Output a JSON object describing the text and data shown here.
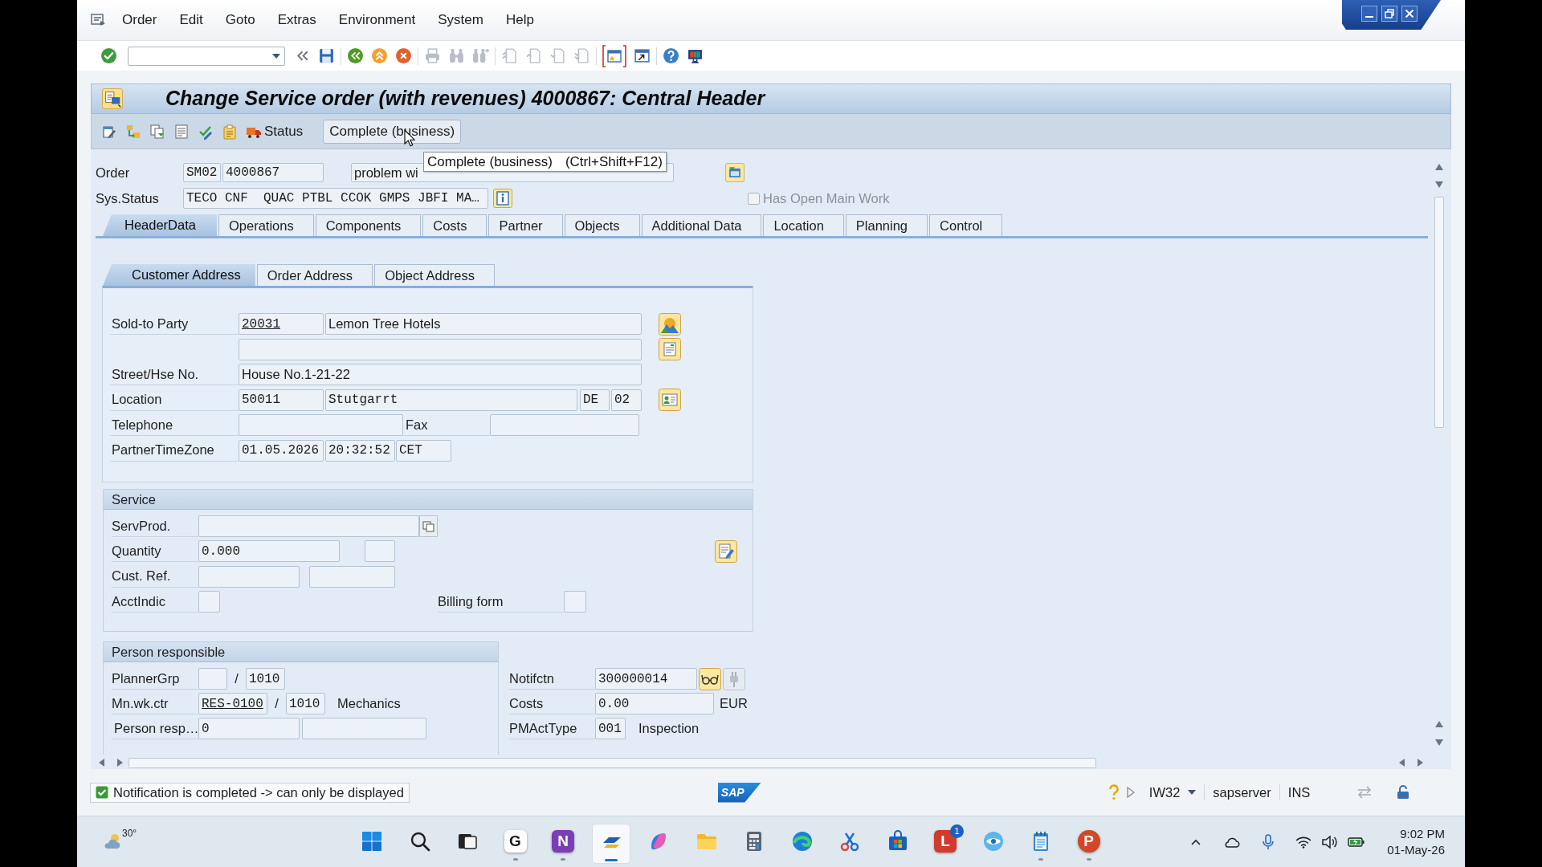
{
  "menu_bar": {
    "items": [
      "Order",
      "Edit",
      "Goto",
      "Extras",
      "Environment",
      "System",
      "Help"
    ]
  },
  "toolbar": {
    "groups": [
      [
        {
          "kind": "enter",
          "disabled": false,
          "focused": false
        }
      ],
      [
        {
          "kind": "collapse",
          "disabled": false,
          "focused": false
        },
        {
          "kind": "save",
          "disabled": false,
          "focused": false
        }
      ],
      [
        {
          "kind": "back",
          "disabled": false,
          "focused": false
        },
        {
          "kind": "exit",
          "disabled": false,
          "focused": false
        },
        {
          "kind": "cancel",
          "disabled": false,
          "focused": false
        }
      ],
      [
        {
          "kind": "print",
          "disabled": true,
          "focused": false
        },
        {
          "kind": "find",
          "disabled": true,
          "focused": false
        },
        {
          "kind": "find_next",
          "disabled": true,
          "focused": false
        }
      ],
      [
        {
          "kind": "first_page",
          "disabled": true,
          "focused": false
        },
        {
          "kind": "previous_page",
          "disabled": true,
          "focused": false
        },
        {
          "kind": "next_page",
          "disabled": true,
          "focused": false
        },
        {
          "kind": "last_page",
          "disabled": true,
          "focused": false
        }
      ],
      [
        {
          "kind": "new_session",
          "disabled": false,
          "focused": true
        },
        {
          "kind": "shortcut",
          "disabled": false,
          "focused": false
        }
      ],
      [
        {
          "kind": "help",
          "disabled": false,
          "focused": false
        },
        {
          "kind": "layout",
          "disabled": false,
          "focused": false
        }
      ]
    ]
  },
  "title": "Change Service order (with revenues) 4000867: Central Header",
  "app_toolbar": {
    "status_button": "Status",
    "complete_button": "Complete (business)"
  },
  "tooltip": {
    "text": "Complete (business)",
    "shortcut": "(Ctrl+Shift+F12)"
  },
  "header": {
    "order": {
      "label": "Order",
      "type": "SM02",
      "number": "4000867",
      "description": "problem wi"
    },
    "sys_status": {
      "label": "Sys.Status",
      "value": "TECO CNF  QUAC PTBL CCOK GMPS JBFI MA…"
    },
    "has_open_main_work": {
      "label": "Has Open Main Work",
      "checked": false,
      "disabled": true
    }
  },
  "tabs": [
    {
      "label": "HeaderData",
      "selected": true
    },
    {
      "label": "Operations",
      "selected": false
    },
    {
      "label": "Components",
      "selected": false
    },
    {
      "label": "Costs",
      "selected": false
    },
    {
      "label": "Partner",
      "selected": false
    },
    {
      "label": "Objects",
      "selected": false
    },
    {
      "label": "Additional Data",
      "selected": false
    },
    {
      "label": "Location",
      "selected": false
    },
    {
      "label": "Planning",
      "selected": false
    },
    {
      "label": "Control",
      "selected": false
    }
  ],
  "subtabs": [
    {
      "label": "Customer Address",
      "selected": true
    },
    {
      "label": "Order Address",
      "selected": false
    },
    {
      "label": "Object Address",
      "selected": false
    }
  ],
  "customer_address": {
    "sold_to_party": {
      "label": "Sold-to Party",
      "number": "20031",
      "link": true,
      "name": "Lemon Tree Hotels"
    },
    "street": {
      "label": "Street/Hse No.",
      "value": "House No.1-21-22"
    },
    "location": {
      "label": "Location",
      "postal_code": "50011",
      "city": "Stutgarrt",
      "country": "DE",
      "code": "02"
    },
    "telephone": {
      "label": "Telephone"
    },
    "fax": {
      "label": "Fax"
    },
    "partner_time_zone": {
      "label": "PartnerTimeZone",
      "date": "01.05.2026",
      "time": "20:32:52",
      "zone": "CET"
    }
  },
  "service": {
    "title": "Service",
    "serv_prod": {
      "label": "ServProd."
    },
    "quantity": {
      "label": "Quantity",
      "value": "0.000"
    },
    "cust_ref": {
      "label": "Cust. Ref."
    },
    "acct_indic": {
      "label": "AcctIndic"
    },
    "billing_form": {
      "label": "Billing form"
    }
  },
  "person_responsible": {
    "title": "Person responsible",
    "planner_group": {
      "label": "PlannerGrp",
      "separator": "/",
      "suffix": "1010"
    },
    "main_work_center": {
      "label": "Mn.wk.ctr",
      "value": "RES-0100",
      "link": true,
      "separator": "/",
      "suffix": "1010",
      "text": "Mechanics"
    },
    "person_resp": {
      "label": "Person resp…",
      "value": "0"
    }
  },
  "order_data": {
    "notification": {
      "label": "Notifctn",
      "value": "300000014"
    },
    "costs": {
      "label": "Costs",
      "value": "0.00",
      "currency": "EUR"
    },
    "activity_type": {
      "label": "PMActType",
      "value": "001",
      "text": "Inspection"
    }
  },
  "status_bar": {
    "message": "Notification is completed -> can only be displayed",
    "logo": "SAP",
    "transaction": "IW32",
    "server": "sapserver",
    "mode": "INS"
  },
  "taskbar": {
    "weather": "30°",
    "apps": [
      {
        "kind": "start",
        "running": false,
        "active": false
      },
      {
        "kind": "search",
        "running": false,
        "active": false
      },
      {
        "kind": "task_view",
        "running": false,
        "active": false
      },
      {
        "kind": "tile",
        "letter": "G",
        "color": "#ffffff",
        "running": true,
        "active": false
      },
      {
        "kind": "tile",
        "letter": "N",
        "color": "#7b3fb5",
        "running": true,
        "active": false
      },
      {
        "kind": "stripes",
        "running": true,
        "active": true
      },
      {
        "kind": "leaf",
        "running": false,
        "active": false
      },
      {
        "kind": "folder",
        "running": false,
        "active": false
      },
      {
        "kind": "calculator",
        "running": false,
        "active": false
      },
      {
        "kind": "swirl",
        "running": false,
        "active": false
      },
      {
        "kind": "scissors",
        "running": false,
        "active": false
      },
      {
        "kind": "bag",
        "running": false,
        "active": false
      },
      {
        "kind": "tile",
        "letter": "L",
        "color": "#d13a2c",
        "running": false,
        "active": false,
        "badge": "1"
      },
      {
        "kind": "eye",
        "running": false,
        "active": false
      },
      {
        "kind": "notepad",
        "running": true,
        "active": false
      },
      {
        "kind": "disc",
        "letter": "P",
        "color": "#d24726",
        "running": true,
        "active": false
      }
    ],
    "time": "9:02 PM",
    "date": "01-May-26"
  }
}
